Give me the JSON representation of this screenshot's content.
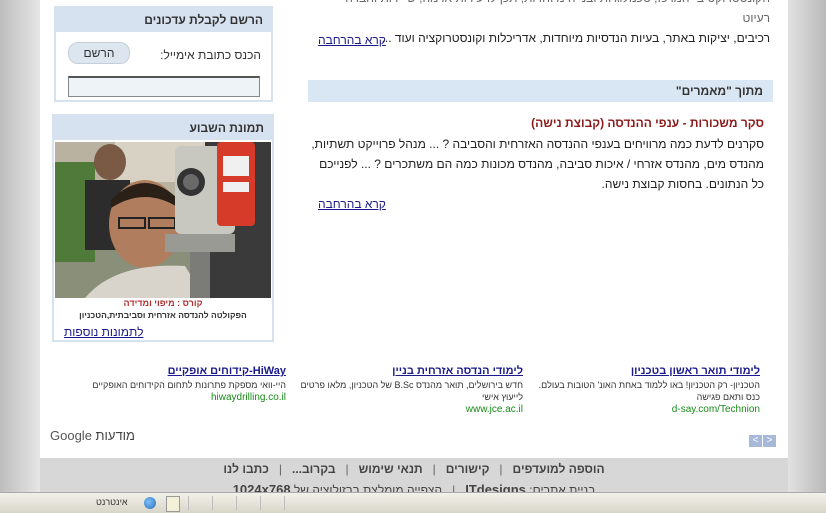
{
  "top_article": {
    "line1": "הקונסטרוקט ב- המרכז, טכנולוגיות ובנייה מיוחדות, תכן לרעידות אדמה, ש' ירות וחברה - רעיוט",
    "line2": "רכיבים, יציקות באתר, בעיות הנדסיות מיוחדות, אדריכלות וקונסטרוקציה ועוד ...",
    "read_more": "קרא בהרחבה"
  },
  "articles_section": {
    "header": "מתוך \"מאמרים\"",
    "title": "סקר משכורות - ענפי ההנדסה (קבוצת נישה)",
    "body": "סקרנים לדעת כמה מרוויחים בענפי ההנדסה האזרחית והסביבה ? ... מנהל פרוייקט תשתיות, מהנדס מים, מהנדס אזרחי / איכות סביבה, מהנדס מכונות כמה הם משתכרים ? ... לפנייכם כל הנתונים. בחסות קבוצת נישה.",
    "read_more": "קרא בהרחבה"
  },
  "newsletter": {
    "header": "הרשם לקבלת עדכונים",
    "email_label": "הכנס כתובת אימייל:",
    "button": "הרשם",
    "input_value": ""
  },
  "photo_of_week": {
    "header": "תמונת השבוע",
    "caption1": "קורס : מיפוי ומדידה",
    "caption2": "הפקולטה להנדסה אזרחית וסביבתית,הטכניון",
    "more_link": "לתמונות נוספות"
  },
  "ads": [
    {
      "title": "לימודי תואר ראשון בטכניון",
      "desc": "הטכניון- רק הטכניון! באו ללמוד באחת האונ' הטובות בעולם. כנס ותאם פגישה",
      "url": "d-say.com/Technion"
    },
    {
      "title": "לימודי הנדסה אזרחית בניין",
      "desc": "חדש בירושלים, תואר מהנדס B.Sc של הטכניון, מלאו פרטים לייעוץ אישי",
      "url": "www.jce.ac.il"
    },
    {
      "title": "HiWay-קידוחים אופקיים",
      "desc": "היי-וואי מספקת פתרונות לתחום הקידוחים האופקיים",
      "url": "hiwaydrilling.co.il"
    }
  ],
  "google_ads_label": {
    "brand": "Google",
    "label": "מודעות"
  },
  "footer": {
    "nav": [
      "הוספה למועדפים",
      "קישורים",
      "תנאי שימוש",
      "בקרוב...",
      "כתבו לנו"
    ],
    "built_by_label": "בניית אתרים:",
    "built_by": "ITdesigns",
    "resolution_note": "הצפייה מומלצת ברזולוציה של",
    "resolution": "1024x768"
  },
  "taskbar": {
    "status_text": "אינטרנט"
  }
}
